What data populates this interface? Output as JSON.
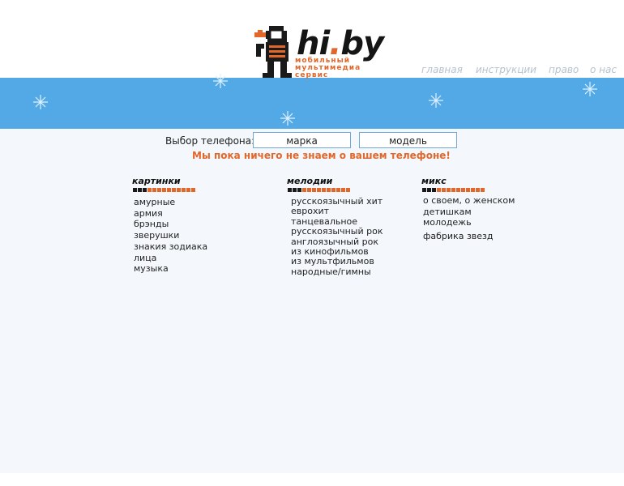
{
  "logo": {
    "wordmark_left": "hi",
    "wordmark_dot": ".",
    "wordmark_right": "by",
    "tagline": [
      "мобильный",
      "мультимедиа",
      "сервис"
    ]
  },
  "nav": {
    "home": "главная",
    "instructions": "инструкции",
    "legal": "право",
    "about": "о нас"
  },
  "phone_select": {
    "label": "Выбор телефона:",
    "brand": "марка",
    "model": "модель",
    "warning": "Мы пока ничего не знаем о вашем телефоне!"
  },
  "categories": [
    {
      "title": "картинки",
      "items": [
        "амурные",
        "армия",
        "брэнды",
        "зверушки",
        "знакия зодиака",
        "лица",
        "музыка"
      ]
    },
    {
      "title": "мелодии",
      "items": [
        "русскоязычный хит",
        "еврохит",
        "танцевальное",
        "русскоязычный рок",
        "англоязычный рок",
        "из кинофильмов",
        "из мультфильмов",
        "народные/гимны"
      ]
    },
    {
      "title": "микс",
      "items": [
        "о своем, о женском",
        "детишкам",
        "молодежь",
        "фабрика звезд"
      ]
    }
  ],
  "colors": {
    "accent": "#e2672a",
    "banner": "#53a9e6",
    "nav_text": "#b6c3cf"
  }
}
